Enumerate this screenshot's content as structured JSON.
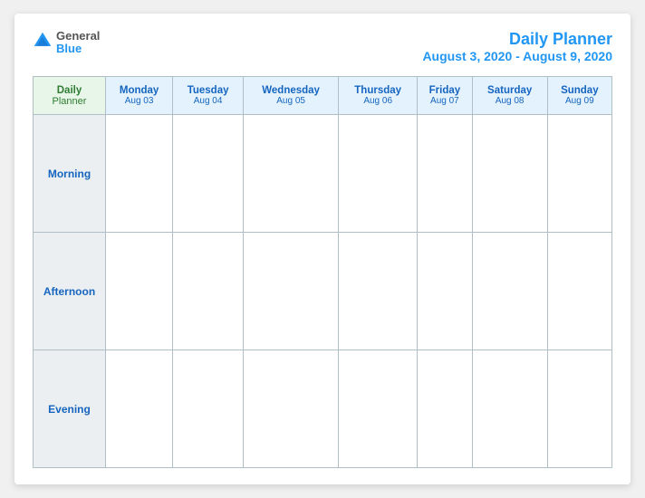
{
  "logo": {
    "general": "General",
    "blue": "Blue"
  },
  "title": {
    "main": "Daily Planner",
    "dates": "August 3, 2020 - August 9, 2020"
  },
  "table": {
    "label_col": {
      "line1": "Daily",
      "line2": "Planner"
    },
    "days": [
      {
        "name": "Monday",
        "date": "Aug 03"
      },
      {
        "name": "Tuesday",
        "date": "Aug 04"
      },
      {
        "name": "Wednesday",
        "date": "Aug 05"
      },
      {
        "name": "Thursday",
        "date": "Aug 06"
      },
      {
        "name": "Friday",
        "date": "Aug 07"
      },
      {
        "name": "Saturday",
        "date": "Aug 08"
      },
      {
        "name": "Sunday",
        "date": "Aug 09"
      }
    ],
    "rows": [
      {
        "label": "Morning"
      },
      {
        "label": "Afternoon"
      },
      {
        "label": "Evening"
      }
    ]
  }
}
